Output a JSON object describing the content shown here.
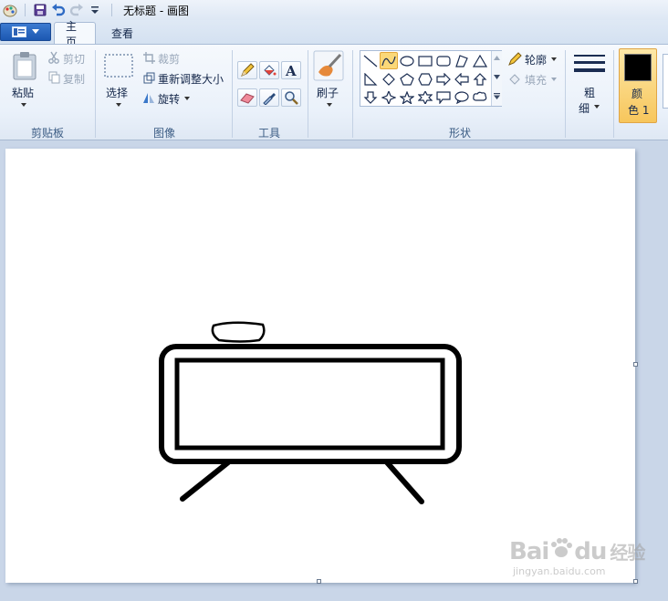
{
  "window": {
    "title": "无标题 - 画图"
  },
  "quick_access": {
    "icons": [
      "paint-app-icon",
      "save-icon",
      "undo-icon",
      "redo-icon",
      "customize-dropdown-icon"
    ]
  },
  "tabs": {
    "home": "主页",
    "view": "查看"
  },
  "clipboard": {
    "paste": "粘贴",
    "cut": "剪切",
    "copy": "复制",
    "group_label": "剪贴板"
  },
  "image": {
    "select": "选择",
    "crop": "裁剪",
    "resize": "重新调整大小",
    "rotate": "旋转",
    "group_label": "图像"
  },
  "tools": {
    "group_label": "工具",
    "items": [
      "pencil-icon",
      "fill-bucket-icon",
      "text-icon",
      "eraser-icon",
      "color-picker-icon",
      "magnifier-icon"
    ]
  },
  "brushes": {
    "label": "刷子"
  },
  "shapes": {
    "outline": "轮廓",
    "fill": "填充",
    "group_label": "形状",
    "selected_shape": "curve"
  },
  "size": {
    "line1": "粗",
    "line2": "细"
  },
  "colors": {
    "line1": "颜",
    "line2": "色 1",
    "color1_value": "#000000",
    "accent": "#fbd878"
  },
  "watermark": {
    "brand": "Bai",
    "brand_suffix": "du",
    "product": "经验",
    "url": "jingyan.baidu.com"
  }
}
